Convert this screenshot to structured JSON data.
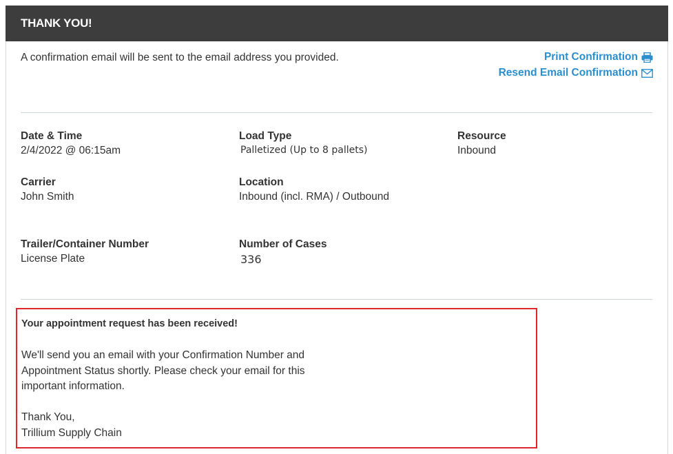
{
  "header": {
    "title": "THANK YOU!"
  },
  "intro": "A confirmation email will be sent to the email address you provided.",
  "actions": {
    "print": {
      "label": "Print Confirmation",
      "icon": "printer-icon"
    },
    "resend": {
      "label": "Resend Email Confirmation",
      "icon": "envelope-icon"
    }
  },
  "accent_color": "#2a8fcf",
  "header_color": "#3d3d3d",
  "details": {
    "date_time": {
      "label": "Date & Time",
      "value": "2/4/2022 @ 06:15am"
    },
    "load_type": {
      "label": "Load Type",
      "value": "Palletized (Up to 8 pallets)"
    },
    "resource": {
      "label": "Resource",
      "value": "Inbound"
    },
    "carrier": {
      "label": "Carrier",
      "value": "John Smith"
    },
    "location": {
      "label": "Location",
      "value": "Inbound (incl. RMA) / Outbound"
    },
    "trailer": {
      "label": "Trailer/Container Number",
      "value": "License Plate"
    },
    "cases": {
      "label": "Number of Cases",
      "value": "336"
    }
  },
  "notice": {
    "border_color": "#e0252b",
    "title": "Your appointment request has been received!",
    "body": "We'll send you an email with your Confirmation Number and Appointment Status shortly. Please check your email for this important information.",
    "thanks": "Thank You,",
    "signature": "Trillium Supply Chain"
  }
}
